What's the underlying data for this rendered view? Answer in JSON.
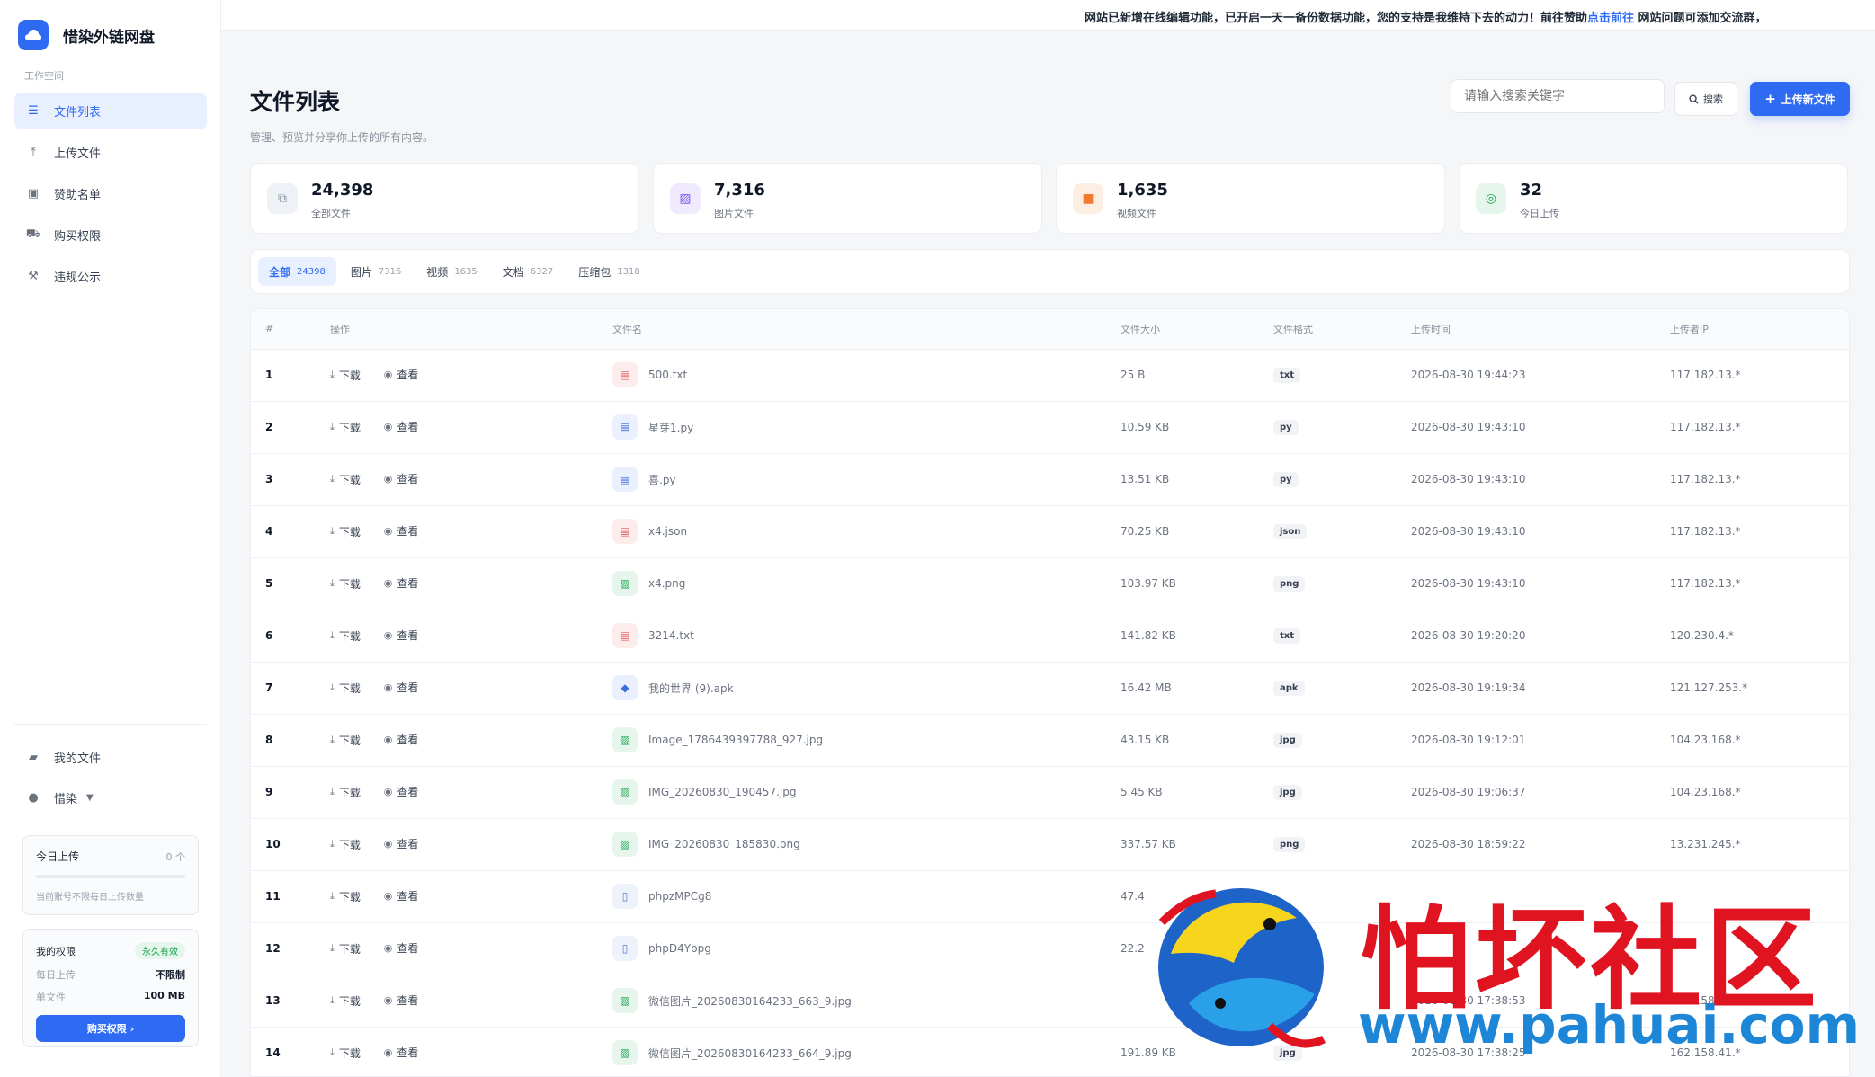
{
  "app": {
    "name": "惜染外链网盘",
    "workspace_label": "工作空间"
  },
  "sidebar": {
    "items": [
      {
        "label": "文件列表",
        "icon": "list-icon",
        "active": true
      },
      {
        "label": "上传文件",
        "icon": "upload-icon",
        "active": false
      },
      {
        "label": "赞助名单",
        "icon": "sponsor-icon",
        "active": false
      },
      {
        "label": "购买权限",
        "icon": "cart-icon",
        "active": false
      },
      {
        "label": "违规公示",
        "icon": "hammer-icon",
        "active": false
      }
    ],
    "bottom_items": [
      {
        "label": "我的文件",
        "icon": "folder-icon"
      },
      {
        "label": "惜染",
        "icon": "user-icon"
      }
    ],
    "today_upload": {
      "title": "今日上传",
      "count": "0 个",
      "note": "当前账号不限每日上传数量",
      "progress": 0
    },
    "quota": {
      "title": "我的权限",
      "badge": "永久有效",
      "daily_label": "每日上传",
      "daily_value": "不限制",
      "single_label": "单文件",
      "single_value": "100 MB",
      "buy_label": "购买权限 ›"
    }
  },
  "banner": {
    "text_before": "网站已新增在线编辑功能，已开启一天一备份数据功能，您的支持是我维持下去的动力！前往赞助",
    "link": "点击前往",
    "text_after": " 网站问题可添加交流群，"
  },
  "header": {
    "title": "文件列表",
    "subtitle": "管理、预览并分享你上传的所有内容。",
    "search_placeholder": "请输入搜索关键字",
    "search_button": "搜索",
    "upload_button": "上传新文件"
  },
  "stats": [
    {
      "value": "24,398",
      "label": "全部文件",
      "icon": "copy-icon",
      "color": "#8a94a6",
      "bg": "#eef1f6"
    },
    {
      "value": "7,316",
      "label": "图片文件",
      "icon": "image-icon",
      "color": "#7c5cf0",
      "bg": "#efeafd"
    },
    {
      "value": "1,635",
      "label": "视频文件",
      "icon": "video-icon",
      "color": "#f27a2f",
      "bg": "#fdeee2"
    },
    {
      "value": "32",
      "label": "今日上传",
      "icon": "clock-icon",
      "color": "#16a34a",
      "bg": "#e7f6ec"
    }
  ],
  "filters": [
    {
      "label": "全部",
      "count": "24398",
      "active": true
    },
    {
      "label": "图片",
      "count": "7316",
      "active": false
    },
    {
      "label": "视频",
      "count": "1635",
      "active": false
    },
    {
      "label": "文档",
      "count": "6327",
      "active": false
    },
    {
      "label": "压缩包",
      "count": "1318",
      "active": false
    }
  ],
  "table": {
    "columns": [
      "#",
      "操作",
      "文件名",
      "文件大小",
      "文件格式",
      "上传时间",
      "上传者IP"
    ],
    "download_label": "下载",
    "view_label": "查看",
    "rows": [
      {
        "idx": "1",
        "name": "500.txt",
        "size": "25 B",
        "ext": "txt",
        "time": "2026-08-30 19:44:23",
        "ip": "117.182.13.*",
        "kind": "doc-red"
      },
      {
        "idx": "2",
        "name": "星芽1.py",
        "size": "10.59 KB",
        "ext": "py",
        "time": "2026-08-30 19:43:10",
        "ip": "117.182.13.*",
        "kind": "code"
      },
      {
        "idx": "3",
        "name": "喜.py",
        "size": "13.51 KB",
        "ext": "py",
        "time": "2026-08-30 19:43:10",
        "ip": "117.182.13.*",
        "kind": "code"
      },
      {
        "idx": "4",
        "name": "x4.json",
        "size": "70.25 KB",
        "ext": "json",
        "time": "2026-08-30 19:43:10",
        "ip": "117.182.13.*",
        "kind": "doc-red"
      },
      {
        "idx": "5",
        "name": "x4.png",
        "size": "103.97 KB",
        "ext": "png",
        "time": "2026-08-30 19:43:10",
        "ip": "117.182.13.*",
        "kind": "image"
      },
      {
        "idx": "6",
        "name": "3214.txt",
        "size": "141.82 KB",
        "ext": "txt",
        "time": "2026-08-30 19:20:20",
        "ip": "120.230.4.*",
        "kind": "doc-red"
      },
      {
        "idx": "7",
        "name": "我的世界 (9).apk",
        "size": "16.42 MB",
        "ext": "apk",
        "time": "2026-08-30 19:19:34",
        "ip": "121.127.253.*",
        "kind": "apk"
      },
      {
        "idx": "8",
        "name": "Image_1786439397788_927.jpg",
        "size": "43.15 KB",
        "ext": "jpg",
        "time": "2026-08-30 19:12:01",
        "ip": "104.23.168.*",
        "kind": "image"
      },
      {
        "idx": "9",
        "name": "IMG_20260830_190457.jpg",
        "size": "5.45 KB",
        "ext": "jpg",
        "time": "2026-08-30 19:06:37",
        "ip": "104.23.168.*",
        "kind": "image"
      },
      {
        "idx": "10",
        "name": "IMG_20260830_185830.png",
        "size": "337.57 KB",
        "ext": "png",
        "time": "2026-08-30 18:59:22",
        "ip": "13.231.245.*",
        "kind": "image"
      },
      {
        "idx": "11",
        "name": "phpzMPCg8",
        "size": "47.4",
        "ext": "",
        "time": "",
        "ip": "",
        "kind": "blank"
      },
      {
        "idx": "12",
        "name": "phpD4Ybpg",
        "size": "22.2",
        "ext": "",
        "time": "",
        "ip": "",
        "kind": "blank"
      },
      {
        "idx": "13",
        "name": "微信图片_20260830164233_663_9.jpg",
        "size": "",
        "ext": "",
        "time": "2026-08-30 17:38:53",
        "ip": "162.158.41.*",
        "kind": "image"
      },
      {
        "idx": "14",
        "name": "微信图片_20260830164233_664_9.jpg",
        "size": "191.89 KB",
        "ext": "jpg",
        "time": "2026-08-30 17:38:25",
        "ip": "162.158.41.*",
        "kind": "image"
      }
    ]
  },
  "watermark": {
    "title": "怕坏社区",
    "url": "www.pahuai.com"
  }
}
